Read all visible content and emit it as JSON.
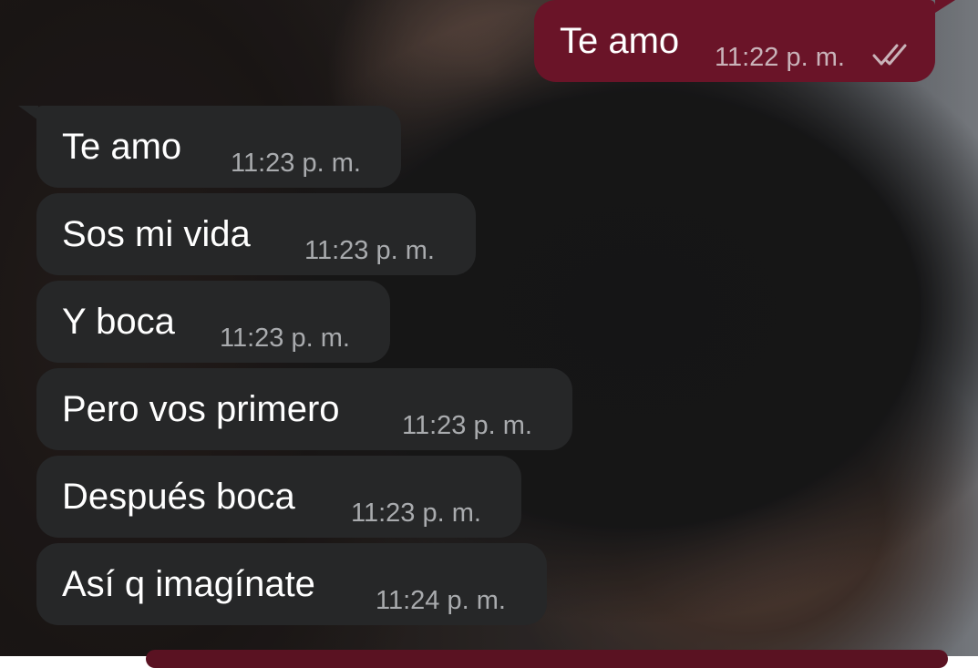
{
  "messages": [
    {
      "direction": "outgoing",
      "text": "Te amo",
      "time": "11:22 p. m.",
      "status": "read",
      "status_icon": "double-check-icon"
    },
    {
      "direction": "incoming",
      "text": "Te amo",
      "time": "11:23 p. m."
    },
    {
      "direction": "incoming",
      "text": "Sos mi vida",
      "time": "11:23 p. m."
    },
    {
      "direction": "incoming",
      "text": "Y boca",
      "time": "11:23 p. m."
    },
    {
      "direction": "incoming",
      "text": "Pero vos primero",
      "time": "11:23 p. m."
    },
    {
      "direction": "incoming",
      "text": "Después boca",
      "time": "11:23 p. m."
    },
    {
      "direction": "incoming",
      "text": "Así q imagínate",
      "time": "11:24 p. m."
    }
  ],
  "colors": {
    "incoming_bubble": "#262728",
    "outgoing_bubble": "#6a1428",
    "message_text": "#ffffff",
    "timestamp": "#a9abae"
  }
}
